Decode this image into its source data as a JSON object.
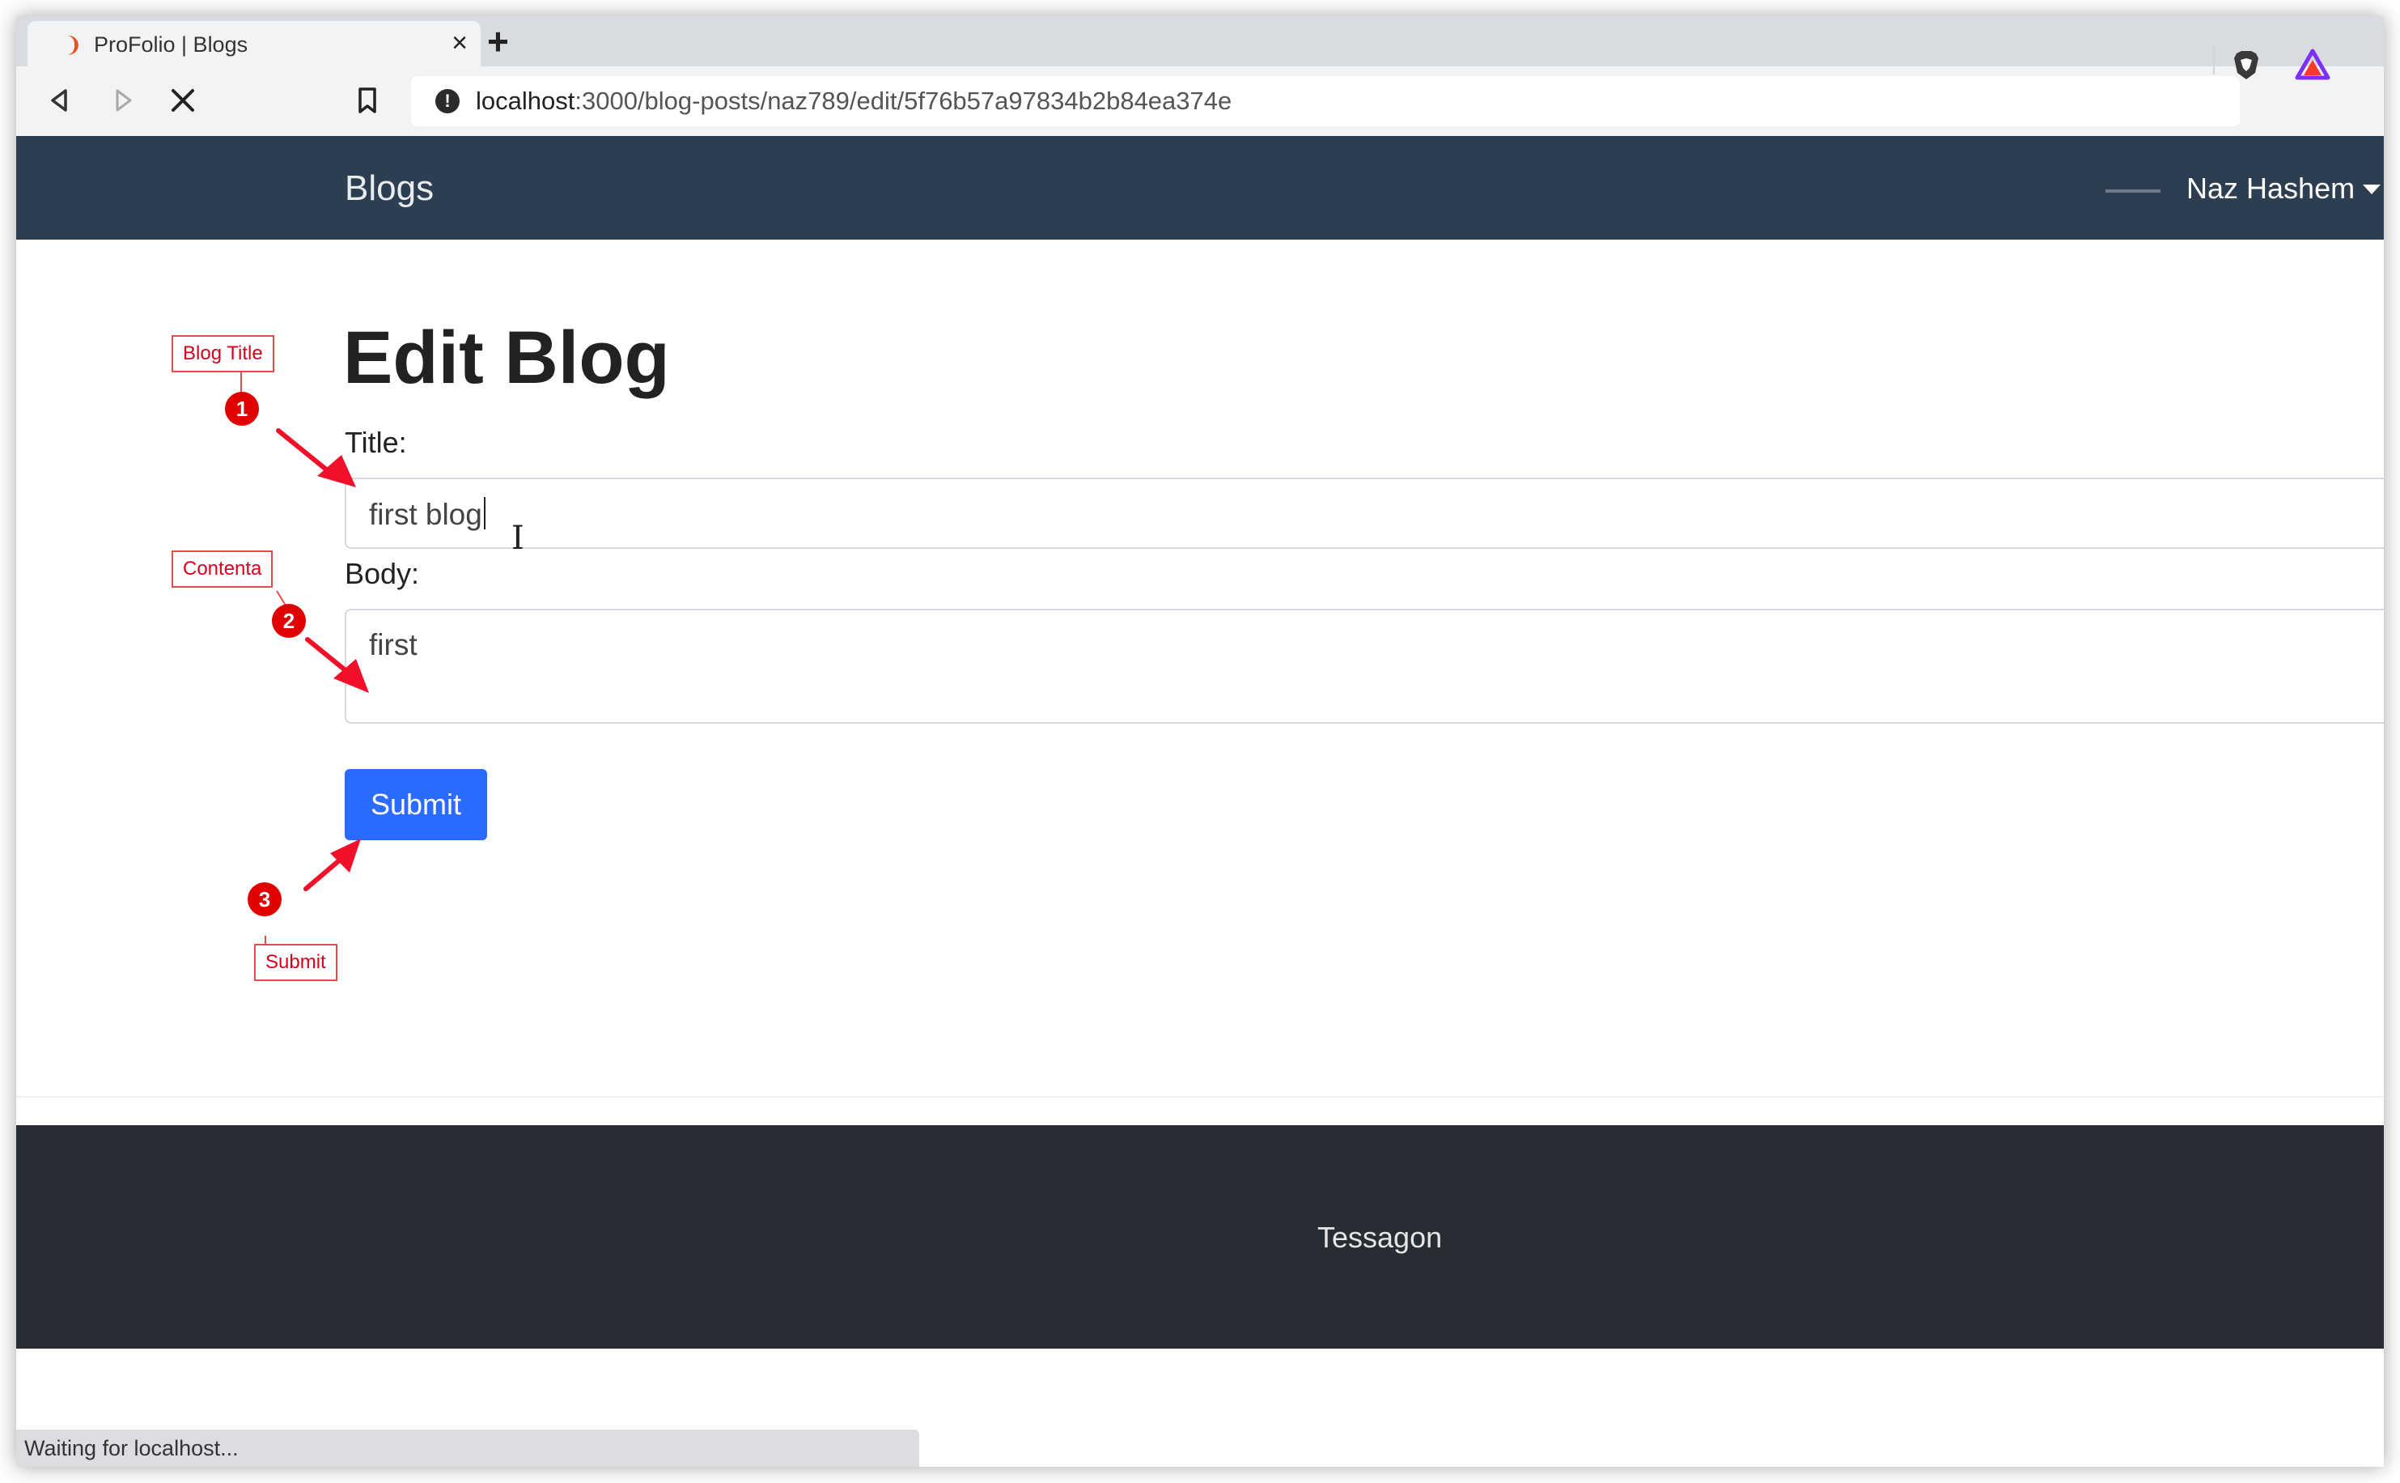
{
  "browser": {
    "tab_title": "ProFolio | Blogs",
    "tab_close": "×",
    "new_tab": "+",
    "url_host": "localhost",
    "url_path": ":3000/blog-posts/naz789/edit/5f76b57a97834b2b84ea374e",
    "status": "Waiting for localhost..."
  },
  "navbar": {
    "brand": "Blogs",
    "user": "Naz Hashem"
  },
  "page": {
    "heading": "Edit Blog",
    "title_label": "Title:",
    "title_value": "first blog",
    "body_label": "Body:",
    "body_value": "first",
    "submit": "Submit"
  },
  "footer": {
    "text": "Tessagon"
  },
  "annotations": [
    {
      "number": "1",
      "label": "Blog Title"
    },
    {
      "number": "2",
      "label": "Contenta"
    },
    {
      "number": "3",
      "label": "Submit"
    }
  ],
  "colors": {
    "navbar": "#2c3e50",
    "footer": "#282c33",
    "primary_button": "#2b6bff",
    "annotation": "#e00000"
  },
  "icons": [
    "brave-favicon-icon",
    "close-icon",
    "plus-icon",
    "back-icon",
    "forward-icon",
    "stop-icon",
    "bookmark-icon",
    "info-icon",
    "brave-shield-icon",
    "brave-rewards-icon",
    "dropdown-caret-icon",
    "text-cursor-icon"
  ]
}
